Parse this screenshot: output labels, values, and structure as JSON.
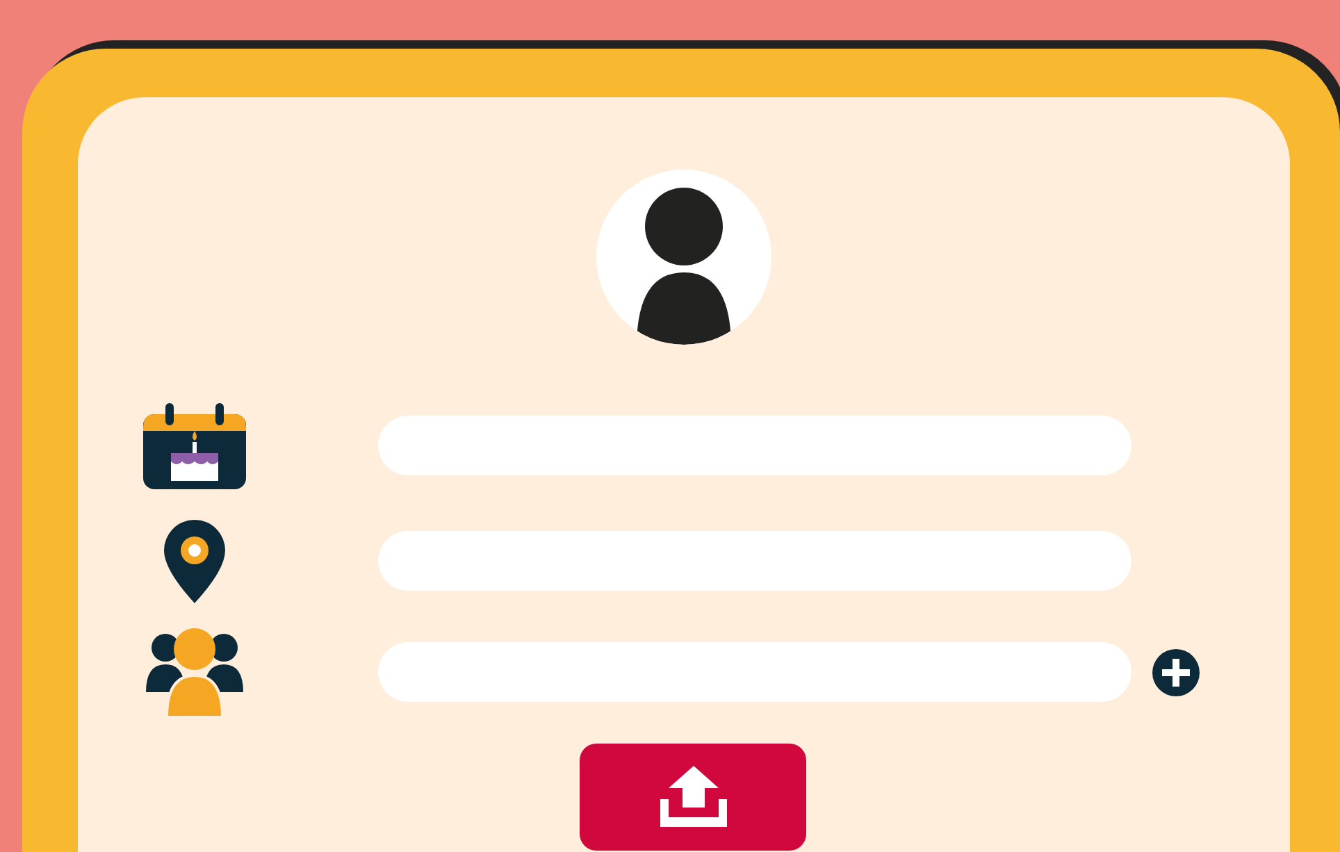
{
  "profile": {
    "avatar": {
      "kind": "silhouette"
    }
  },
  "rows": [
    {
      "kind": "birthday",
      "add_button": false
    },
    {
      "kind": "location",
      "add_button": false
    },
    {
      "kind": "group",
      "add_button": true
    }
  ],
  "submit": {
    "kind": "upload"
  }
}
